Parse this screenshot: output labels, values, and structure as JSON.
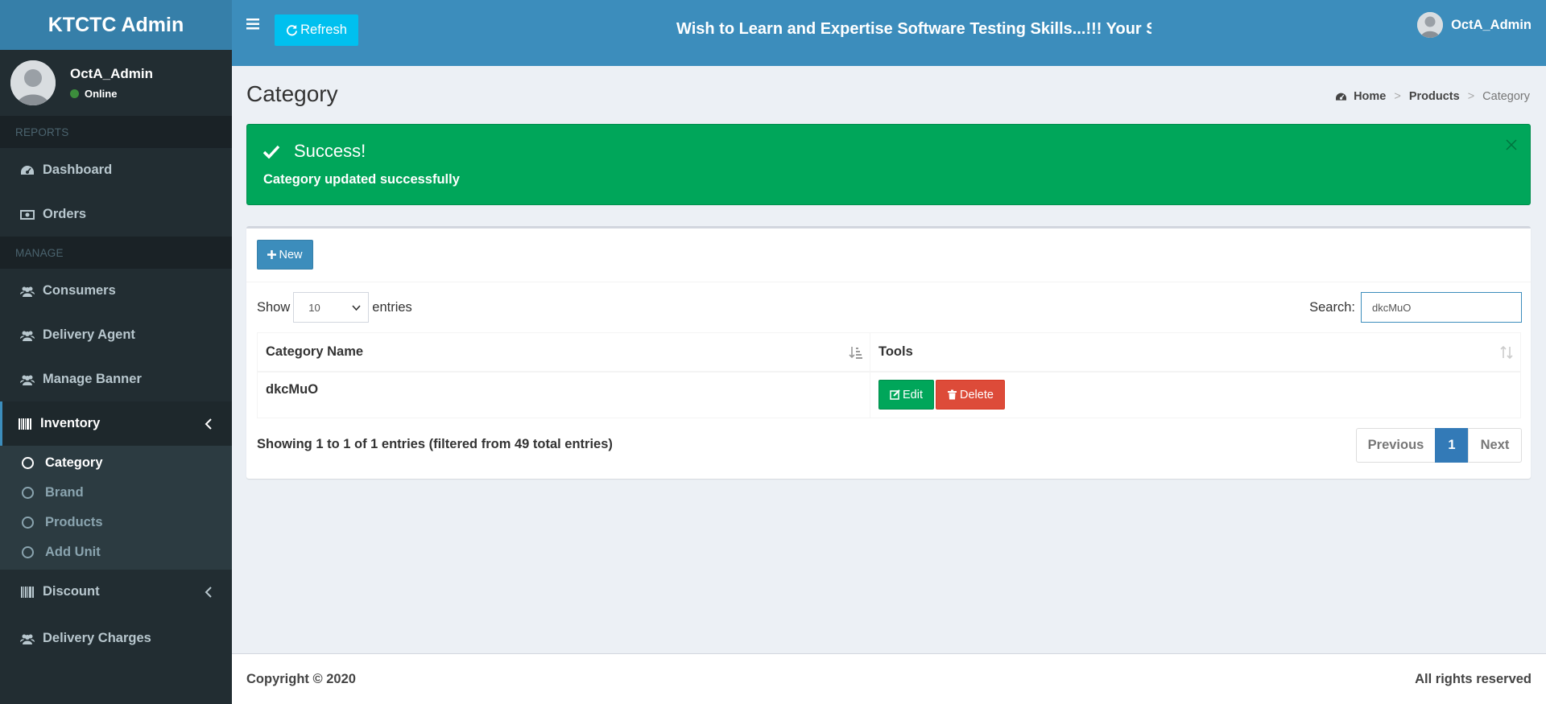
{
  "app": {
    "logo": "KTCTC Admin"
  },
  "sidebar": {
    "user_name": "OctA_Admin",
    "user_status": "Online",
    "sections": {
      "reports": "REPORTS",
      "manage": "MANAGE"
    },
    "items": {
      "dashboard": "Dashboard",
      "orders": "Orders",
      "consumers": "Consumers",
      "delivery_agent": "Delivery Agent",
      "manage_banner": "Manage Banner",
      "inventory": "Inventory",
      "discount": "Discount",
      "delivery_charges": "Delivery Charges"
    },
    "inventory_sub": {
      "category": "Category",
      "brand": "Brand",
      "products": "Products",
      "add_unit": "Add Unit"
    }
  },
  "header": {
    "refresh_label": "Refresh",
    "marquee": "Wish to Learn and Expertise Software Testing Skills...!!! Your Se",
    "user_name": "OctA_Admin"
  },
  "page": {
    "title": "Category",
    "breadcrumb": {
      "home": "Home",
      "products": "Products",
      "current": "Category",
      "separator": ">"
    }
  },
  "alert": {
    "title": "Success!",
    "message": "Category updated successfully",
    "color": "#00a65a"
  },
  "table_controls": {
    "new_label": "New",
    "show_label": "Show",
    "entries_label": "entries",
    "page_length": "10",
    "search_label": "Search:",
    "search_value": "dkcMuO"
  },
  "table": {
    "headers": {
      "category_name": "Category Name",
      "tools": "Tools"
    },
    "rows": [
      {
        "category_name": "dkcMuO",
        "edit_label": "Edit",
        "delete_label": "Delete"
      }
    ],
    "info": "Showing 1 to 1 of 1 entries (filtered from 49 total entries)"
  },
  "pagination": {
    "previous": "Previous",
    "current": "1",
    "next": "Next"
  },
  "footer": {
    "copyright": "Copyright © 2020",
    "rights": "All rights reserved"
  }
}
